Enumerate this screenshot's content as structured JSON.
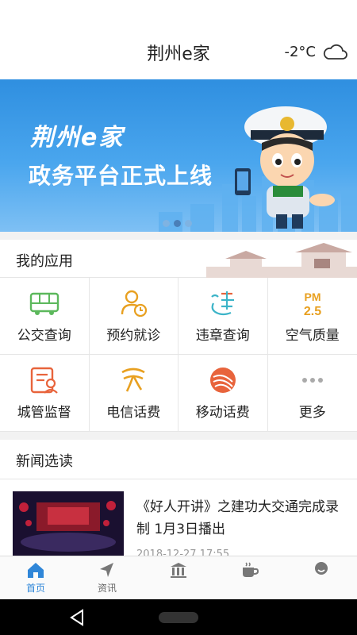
{
  "header": {
    "title": "荆州e家",
    "temperature": "-2°C",
    "weather_icon": "cloud-icon"
  },
  "banner": {
    "brand": "荆州e家",
    "slogan": "政务平台正式上线",
    "slides": 3,
    "active_slide": 2
  },
  "apps": {
    "section_title": "我的应用",
    "items": [
      {
        "label": "公交查询",
        "icon": "bus-icon",
        "color": "#5cb85c"
      },
      {
        "label": "预约就诊",
        "icon": "appointment-icon",
        "color": "#e8a020"
      },
      {
        "label": "违章查询",
        "icon": "violation-icon",
        "color": "#3cb4c8"
      },
      {
        "label": "空气质量",
        "icon": "pm25-icon",
        "color": "#e8a020"
      },
      {
        "label": "城管监督",
        "icon": "city-management-icon",
        "color": "#e8643c"
      },
      {
        "label": "电信话费",
        "icon": "telecom-icon",
        "color": "#e8a020"
      },
      {
        "label": "移动话费",
        "icon": "mobile-icon",
        "color": "#e8643c"
      },
      {
        "label": "更多",
        "icon": "more-icon",
        "color": "#aaaaaa"
      }
    ]
  },
  "news": {
    "section_title": "新闻选读",
    "items": [
      {
        "title": "《好人开讲》之建功大交通完成录制 1月3日播出",
        "date": "2018-12-27 17:55"
      }
    ]
  },
  "tabs": [
    {
      "label": "首页",
      "icon": "home-icon",
      "active": true
    },
    {
      "label": "资讯",
      "icon": "navigation-icon",
      "active": false
    },
    {
      "label": "",
      "icon": "government-icon",
      "active": false
    },
    {
      "label": "",
      "icon": "coffee-icon",
      "active": false
    },
    {
      "label": "",
      "icon": "profile-icon",
      "active": false
    }
  ],
  "colors": {
    "accent": "#2f86d8",
    "banner_blue": "#3a9ae6"
  }
}
